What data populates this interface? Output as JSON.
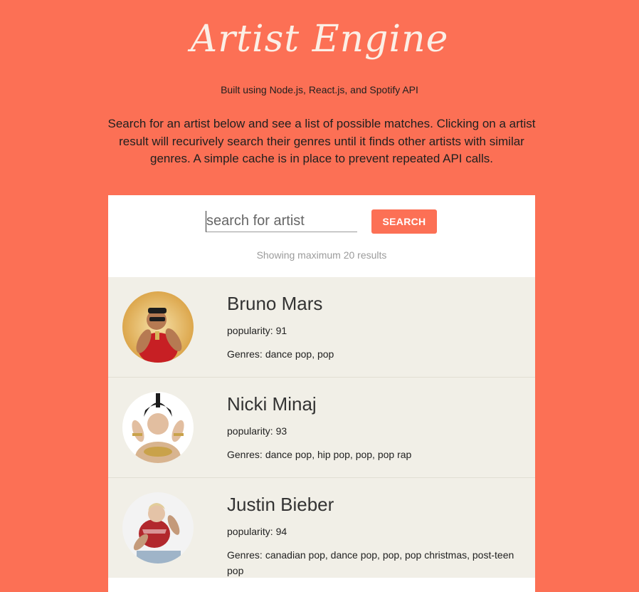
{
  "header": {
    "title": "Artist Engine",
    "subtitle": "Built using Node.js, React.js, and Spotify API",
    "description": "Search for an artist below and see a list of possible matches. Clicking on a artist result will recurively search their genres until it finds other artists with similar genres. A simple cache is in place to prevent repeated API calls."
  },
  "search": {
    "placeholder": "search for artist",
    "button_label": "SEARCH",
    "results_note": "Showing maximum 20 results"
  },
  "labels": {
    "popularity": "popularity:",
    "genres": "Genres:"
  },
  "results": [
    {
      "name": "Bruno Mars",
      "popularity": "91",
      "genres": "dance pop, pop"
    },
    {
      "name": "Nicki Minaj",
      "popularity": "93",
      "genres": "dance pop, hip pop, pop, pop rap"
    },
    {
      "name": "Justin Bieber",
      "popularity": "94",
      "genres": "canadian pop, dance pop, pop, pop christmas, post-teen pop"
    }
  ],
  "colors": {
    "background": "#fc7055",
    "accent": "#fc7055",
    "card": "#f1efe7",
    "title": "#fbefe6"
  }
}
